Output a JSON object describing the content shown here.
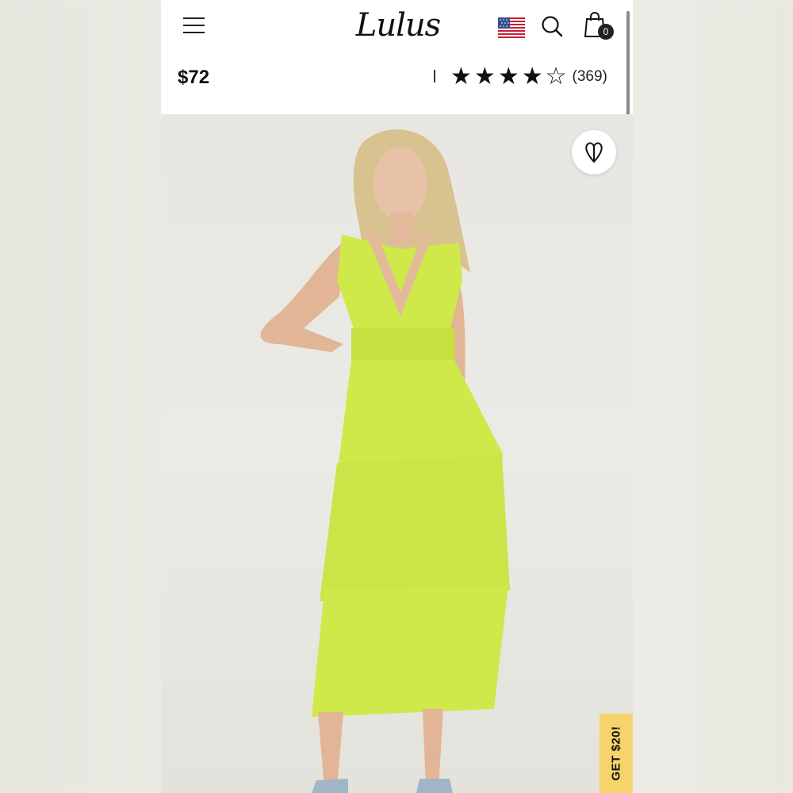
{
  "header": {
    "logo_text": "Lulus",
    "cart_count": "0",
    "icons": {
      "menu": "hamburger-menu-icon",
      "flag": "us-flag-icon",
      "search": "search-icon",
      "bag": "shopping-bag-icon"
    }
  },
  "product": {
    "price": "$72",
    "rating": 4,
    "rating_max": 5,
    "review_count": "(369)",
    "image_colors": {
      "dress": "#cfe84a",
      "background": "#e9e7e2"
    }
  },
  "wishlist": {
    "icon": "heart-icon"
  },
  "promo": {
    "label": "GET $20!",
    "color": "#f7d46b"
  }
}
